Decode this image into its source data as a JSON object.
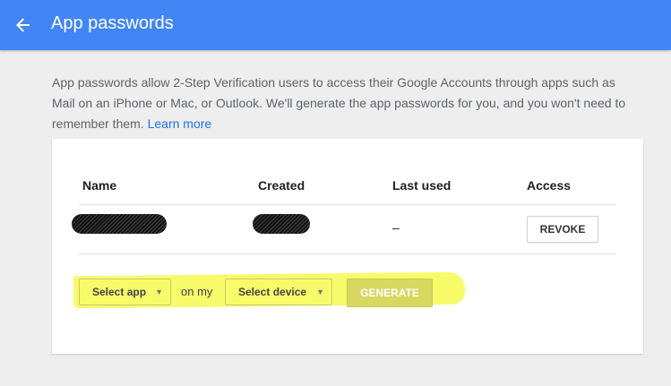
{
  "header": {
    "title": "App passwords",
    "back_icon": "arrow-left-icon",
    "bg_color": "#4285f4"
  },
  "intro": {
    "text": "App passwords allow 2-Step Verification users to access their Google Accounts through apps such as Mail on an iPhone or Mac, or Outlook. We'll generate the app passwords for you, and you won't need to remember them.",
    "link": "Learn more",
    "link_color": "#1a73e8"
  },
  "table": {
    "columns": [
      "Name",
      "Created",
      "Last used",
      "Access"
    ],
    "rows": [
      {
        "last_used": "–",
        "action": "REVOKE"
      }
    ]
  },
  "generator": {
    "app_select": "Select app",
    "joiner": "on my",
    "device_select": "Select device",
    "generate_label": "GENERATE",
    "caret_icon": "caret-down-icon"
  }
}
